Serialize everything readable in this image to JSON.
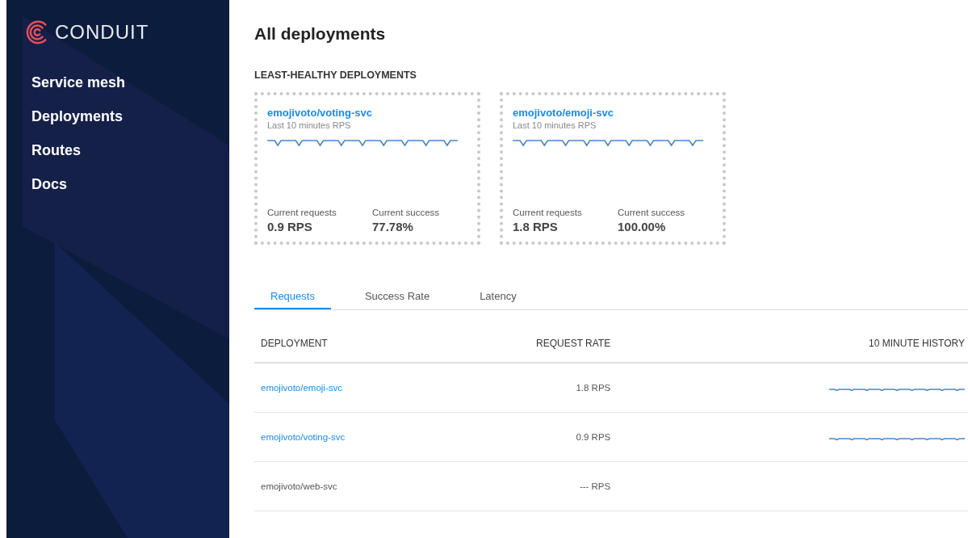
{
  "sidebar": {
    "logo": "CONDUIT",
    "items": [
      {
        "label": "Service mesh"
      },
      {
        "label": "Deployments"
      },
      {
        "label": "Routes"
      },
      {
        "label": "Docs"
      }
    ]
  },
  "page": {
    "title": "All deployments"
  },
  "least_healthy": {
    "heading": "LEAST-HEALTHY DEPLOYMENTS",
    "cards": [
      {
        "name": "emojivoto/voting-svc",
        "subtitle": "Last 10 minutes RPS",
        "requests_label": "Current requests",
        "requests": "0.9 RPS",
        "success_label": "Current success",
        "success": "77.78%"
      },
      {
        "name": "emojivoto/emoji-svc",
        "subtitle": "Last 10 minutes RPS",
        "requests_label": "Current requests",
        "requests": "1.8 RPS",
        "success_label": "Current success",
        "success": "100.00%"
      }
    ]
  },
  "tabs": [
    {
      "label": "Requests",
      "selected": true
    },
    {
      "label": "Success Rate",
      "selected": false
    },
    {
      "label": "Latency",
      "selected": false
    }
  ],
  "table": {
    "columns": [
      "DEPLOYMENT",
      "REQUEST RATE",
      "10 MINUTE HISTORY"
    ],
    "rows": [
      {
        "deployment": "emojivoto/emoji-svc",
        "linked": true,
        "request_rate": "1.8 RPS",
        "has_history": true
      },
      {
        "deployment": "emojivoto/voting-svc",
        "linked": true,
        "request_rate": "0.9 RPS",
        "has_history": true
      },
      {
        "deployment": "emojivoto/web-svc",
        "linked": false,
        "request_rate": "--- RPS",
        "has_history": false
      }
    ]
  }
}
